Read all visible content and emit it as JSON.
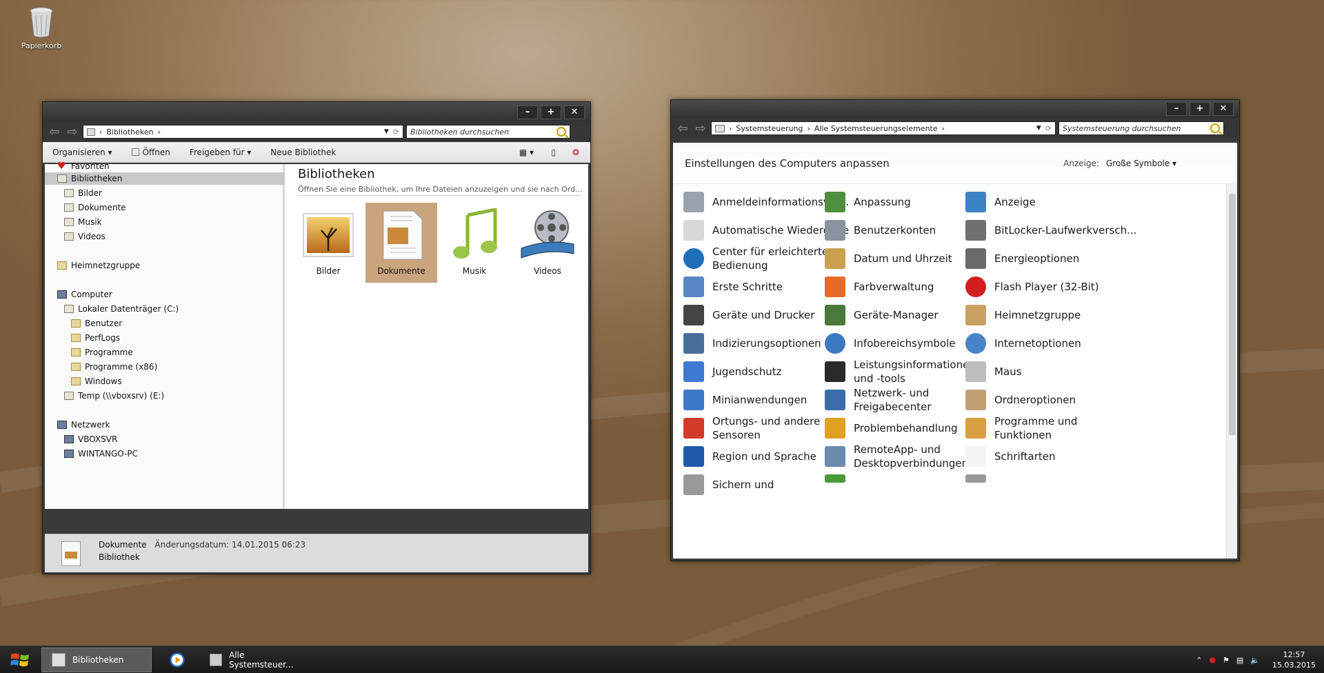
{
  "desktop": {
    "recycle_bin_label": "Papierkorb"
  },
  "explorer": {
    "window_buttons": {
      "minimize": "–",
      "maximize": "+",
      "close": "✕"
    },
    "address": {
      "crumb": "Bibliotheken",
      "sep": "›"
    },
    "search_placeholder": "Bibliotheken durchsuchen",
    "toolbar": {
      "organize": "Organisieren ▾",
      "open": "Öffnen",
      "share": "Freigeben für ▾",
      "new_library": "Neue Bibliothek"
    },
    "nav": {
      "favorites": "Favoriten",
      "libraries": "Bibliotheken",
      "pictures": "Bilder",
      "documents": "Dokumente",
      "music": "Musik",
      "videos": "Videos",
      "homegroup": "Heimnetzgruppe",
      "computer": "Computer",
      "drive_c": "Lokaler Datenträger (C:)",
      "users": "Benutzer",
      "perflogs": "PerfLogs",
      "programs": "Programme",
      "programs_x86": "Programme (x86)",
      "windows": "Windows",
      "temp": "Temp (\\\\vboxsrv) (E:)",
      "network": "Netzwerk",
      "vboxsvr": "VBOXSVR",
      "wintango": "WINTANGO-PC"
    },
    "content": {
      "heading": "Bibliotheken",
      "subtitle": "Öffnen Sie eine Bibliothek, um Ihre Dateien anzuzeigen und sie nach Ord...",
      "libraries": [
        "Bilder",
        "Dokumente",
        "Musik",
        "Videos"
      ]
    },
    "status": {
      "name": "Dokumente",
      "modified": "Änderungsdatum: 14.01.2015 06:23",
      "type": "Bibliothek"
    }
  },
  "cpanel": {
    "window_buttons": {
      "minimize": "–",
      "maximize": "+",
      "close": "✕"
    },
    "address": {
      "crumb1": "Systemsteuerung",
      "crumb2": "Alle Systemsteuerungselemente",
      "sep": "›"
    },
    "search_placeholder": "Systemsteuerung durchsuchen",
    "header": {
      "title": "Einstellungen des Computers anpassen",
      "view_label": "Anzeige:",
      "view_value": "Große Symbole ▾"
    },
    "items": [
      [
        "Anmeldeinformationsver...",
        "Anpassung",
        "Anzeige"
      ],
      [
        "Automatische Wiedergabe",
        "Benutzerkonten",
        "BitLocker-Laufwerkversch..."
      ],
      [
        "Center für erleichterte Bedienung",
        "Datum und Uhrzeit",
        "Energieoptionen"
      ],
      [
        "Erste Schritte",
        "Farbverwaltung",
        "Flash Player (32-Bit)"
      ],
      [
        "Geräte und Drucker",
        "Geräte-Manager",
        "Heimnetzgruppe"
      ],
      [
        "Indizierungsoptionen",
        "Infobereichsymbole",
        "Internetoptionen"
      ],
      [
        "Jugendschutz",
        "Leistungsinformationen und -tools",
        "Maus"
      ],
      [
        "Minianwendungen",
        "Netzwerk- und Freigabecenter",
        "Ordneroptionen"
      ],
      [
        "Ortungs- und andere Sensoren",
        "Problembehandlung",
        "Programme und Funktionen"
      ],
      [
        "Region und Sprache",
        "RemoteApp- und Desktopverbindungen",
        "Schriftarten"
      ],
      [
        "Sichern und",
        "",
        ""
      ]
    ]
  },
  "taskbar": {
    "items": [
      "Bibliotheken",
      "Alle Systemsteuer..."
    ],
    "time": "12:57",
    "date": "15.03.2015"
  }
}
